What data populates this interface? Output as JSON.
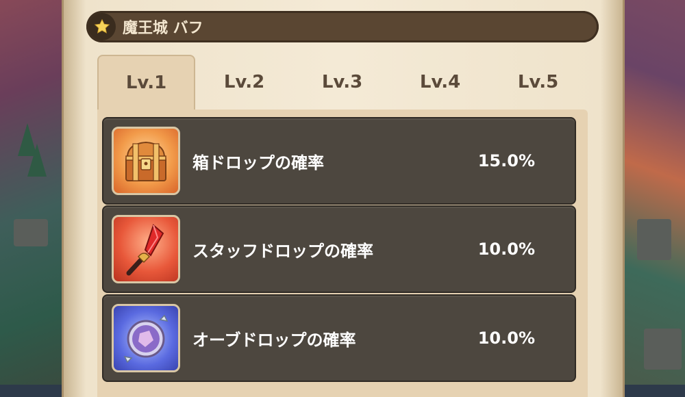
{
  "header": {
    "title": "魔王城 バフ",
    "icon": "star-icon"
  },
  "tabs": [
    {
      "label": "Lv.1",
      "active": true
    },
    {
      "label": "Lv.2",
      "active": false
    },
    {
      "label": "Lv.3",
      "active": false
    },
    {
      "label": "Lv.4",
      "active": false
    },
    {
      "label": "Lv.5",
      "active": false
    }
  ],
  "buffs": [
    {
      "icon": "treasure-chest-icon",
      "label": "箱ドロップの確率",
      "value": "15.0%"
    },
    {
      "icon": "staff-icon",
      "label": "スタッフドロップの確率",
      "value": "10.0%"
    },
    {
      "icon": "orb-icon",
      "label": "オーブドロップの確率",
      "value": "10.0%"
    }
  ],
  "colors": {
    "header_bg": "#5a4632",
    "row_bg": "#4d473f",
    "tab_active_bg": "#e6d2b2",
    "parchment": "#f4ead6",
    "text_light": "#ffffff",
    "tab_text": "#5b4a3a"
  }
}
